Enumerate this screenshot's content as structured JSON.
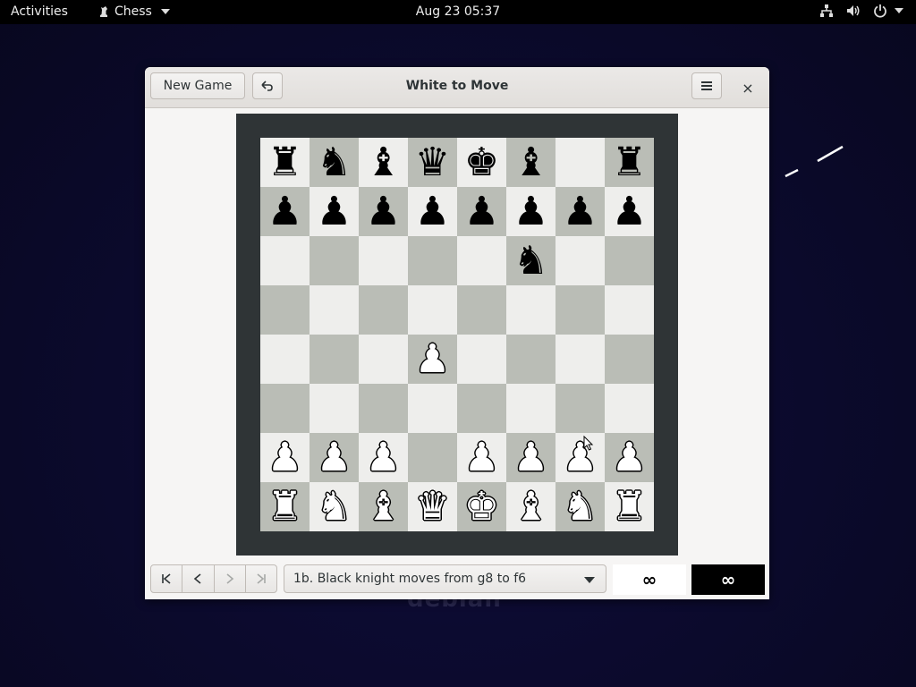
{
  "topbar": {
    "activities": "Activities",
    "app_name": "Chess",
    "clock": "Aug 23  05:37",
    "icons": [
      "network-icon",
      "volume-icon",
      "power-icon"
    ]
  },
  "window": {
    "title": "White to Move",
    "new_game_label": "New Game",
    "undo_icon": "undo-icon",
    "menu_icon": "hamburger-menu-icon",
    "close_label": "×"
  },
  "board": {
    "light_color": "#eeeeec",
    "dark_color": "#babdb6",
    "frame_color": "#2f3436",
    "rows": [
      [
        "br",
        "bn",
        "bb",
        "bq",
        "bk",
        "bb",
        "",
        "br"
      ],
      [
        "bp",
        "bp",
        "bp",
        "bp",
        "bp",
        "bp",
        "bp",
        "bp"
      ],
      [
        "",
        "",
        "",
        "",
        "",
        "bn",
        "",
        ""
      ],
      [
        "",
        "",
        "",
        "",
        "",
        "",
        "",
        ""
      ],
      [
        "",
        "",
        "",
        "wp",
        "",
        "",
        "",
        ""
      ],
      [
        "",
        "",
        "",
        "",
        "",
        "",
        "",
        ""
      ],
      [
        "wp",
        "wp",
        "wp",
        "",
        "wp",
        "wp",
        "wp",
        "wp"
      ],
      [
        "wr",
        "wn",
        "wb",
        "wq",
        "wk",
        "wb",
        "wn",
        "wr"
      ]
    ]
  },
  "bottombar": {
    "nav": {
      "first": "K",
      "prev": "<",
      "next": ">",
      "last": ">I"
    },
    "history_selected": "1b. Black knight moves from g8 to f6",
    "white_clock": "∞",
    "black_clock": "∞"
  }
}
